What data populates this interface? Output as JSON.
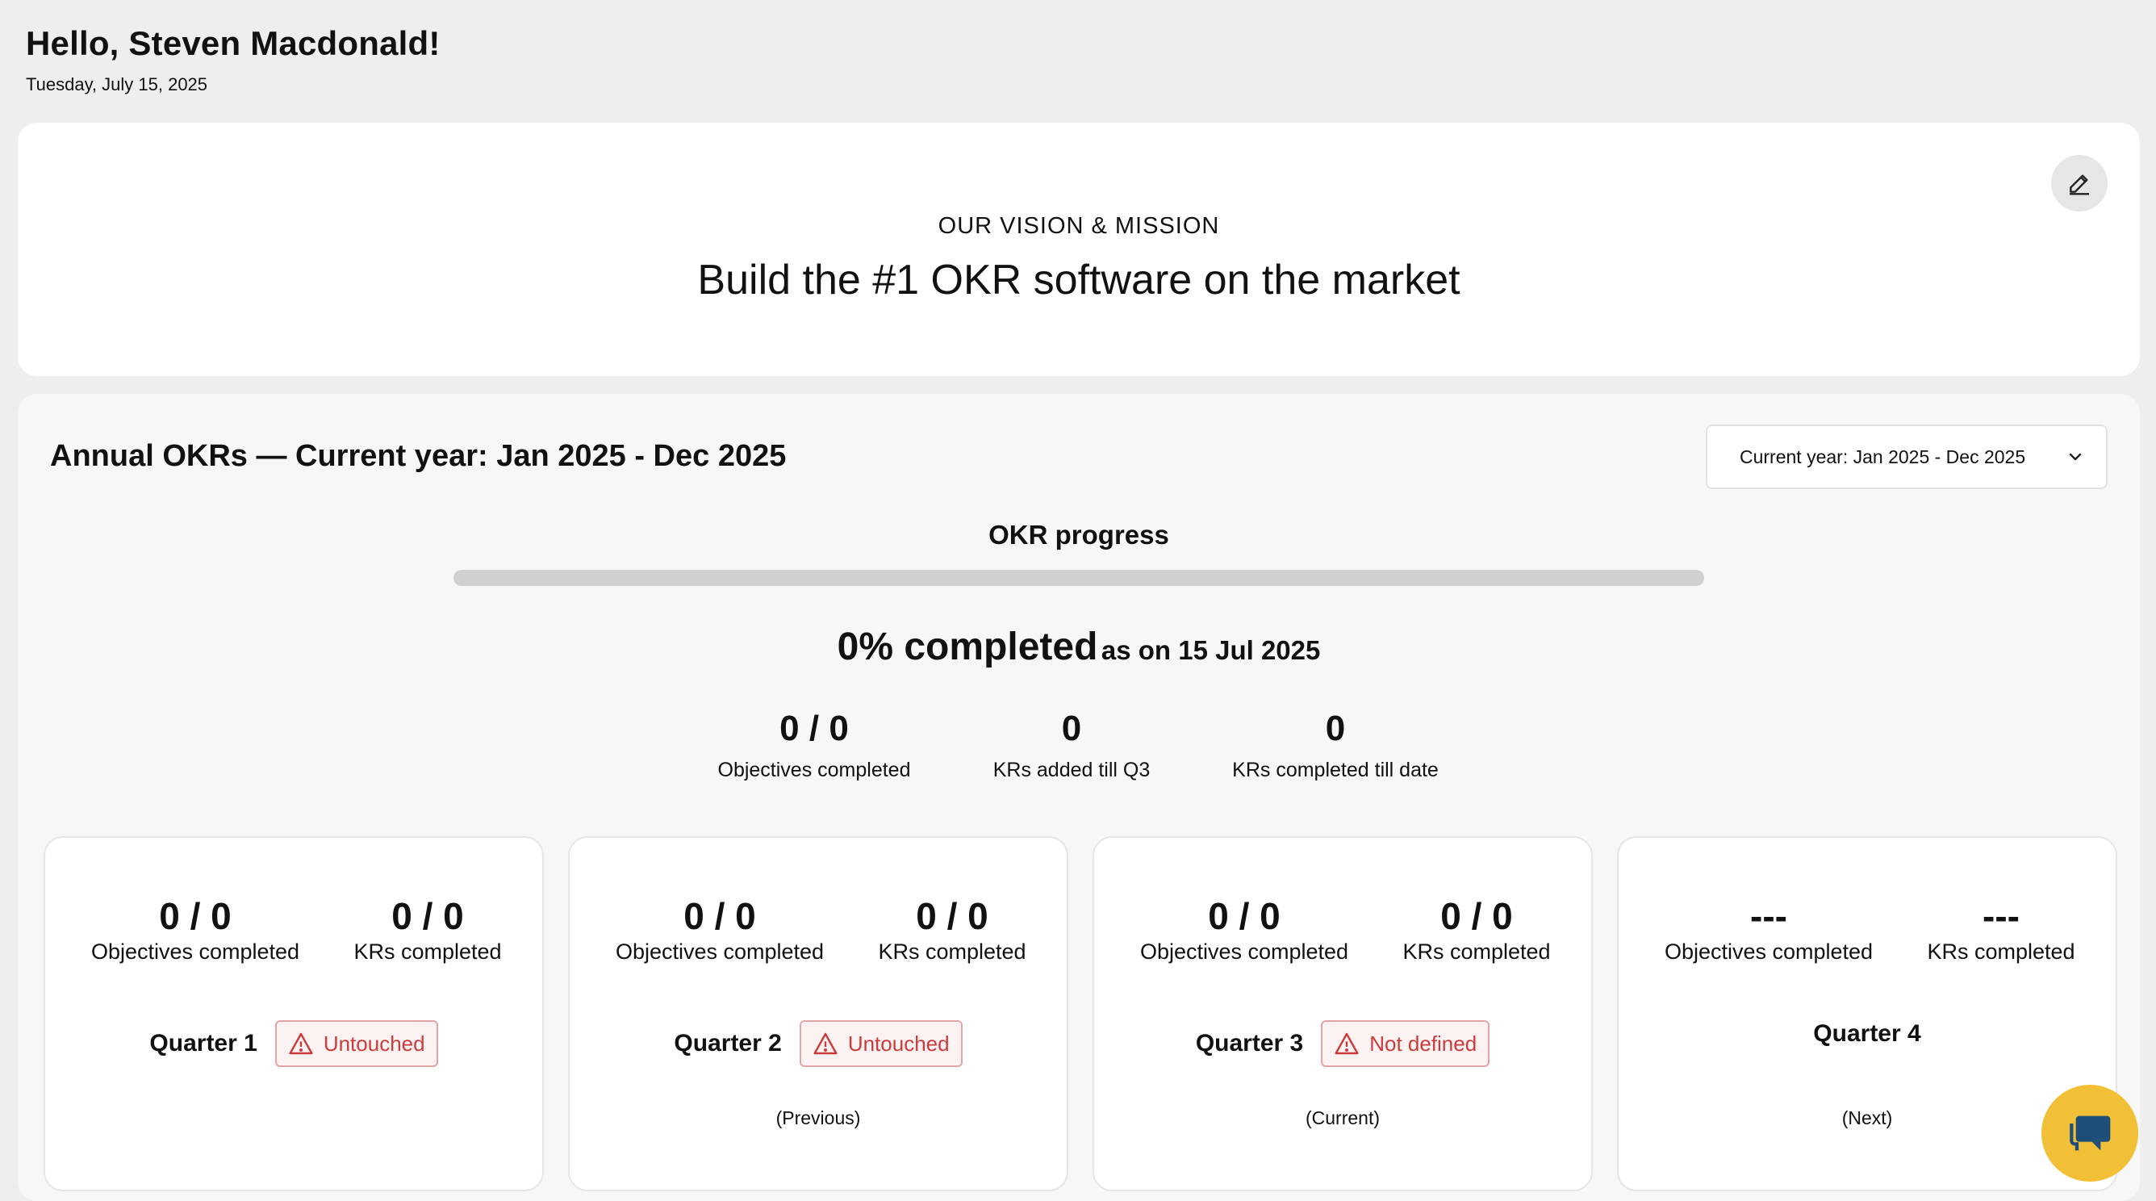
{
  "header": {
    "greeting": "Hello, Steven Macdonald!",
    "date": "Tuesday, July 15, 2025"
  },
  "vision": {
    "label": "OUR VISION & MISSION",
    "statement": "Build the #1 OKR software on the market",
    "edit_icon": "pencil-icon"
  },
  "annual": {
    "title": "Annual OKRs — Current year: Jan 2025 - Dec 2025",
    "year_select": {
      "value": "Current year: Jan 2025 - Dec 2025",
      "icon": "chevron-down-icon"
    },
    "progress": {
      "title": "OKR progress",
      "fraction": 0,
      "completed": "0% completed",
      "as_of": "as on 15 Jul 2025"
    },
    "summary": [
      {
        "value": "0 / 0",
        "label": "Objectives completed"
      },
      {
        "value": "0",
        "label": "KRs added till Q3"
      },
      {
        "value": "0",
        "label": "KRs completed till date"
      }
    ]
  },
  "quarters": [
    {
      "obj_value": "0 / 0",
      "obj_label": "Objectives completed",
      "kr_value": "0 / 0",
      "kr_label": "KRs completed",
      "name": "Quarter 1",
      "status": "Untouched",
      "sub": ""
    },
    {
      "obj_value": "0 / 0",
      "obj_label": "Objectives completed",
      "kr_value": "0 / 0",
      "kr_label": "KRs completed",
      "name": "Quarter 2",
      "status": "Untouched",
      "sub": "(Previous)"
    },
    {
      "obj_value": "0 / 0",
      "obj_label": "Objectives completed",
      "kr_value": "0 / 0",
      "kr_label": "KRs completed",
      "name": "Quarter 3",
      "status": "Not defined",
      "sub": "(Current)"
    },
    {
      "obj_value": "---",
      "obj_label": "Objectives completed",
      "kr_value": "---",
      "kr_label": "KRs completed",
      "name": "Quarter 4",
      "status": "",
      "sub": "(Next)"
    }
  ],
  "colors": {
    "badge_red": "#cc3b3b",
    "chat_yellow": "#f2c037",
    "chat_icon": "#1f4e79"
  },
  "chat": {
    "icon": "chat-bubble-icon"
  }
}
